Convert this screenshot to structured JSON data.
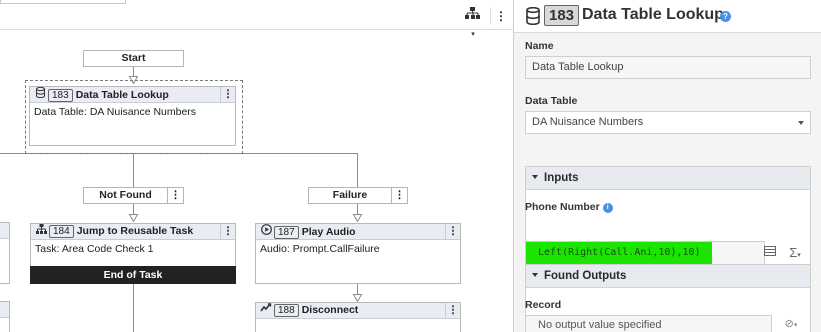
{
  "canvas": {
    "start_label": "Start",
    "data_table_node": {
      "id": "183",
      "title": "Data Table Lookup",
      "body": "Data Table: DA Nuisance Numbers",
      "kebab": "⋮"
    },
    "not_found_label": "Not Found",
    "failure_label": "Failure",
    "jump_node": {
      "id": "184",
      "title": "Jump to Reusable Task",
      "body": "Task: Area Code Check 1",
      "footer": "End of Task",
      "kebab": "⋮"
    },
    "play_audio_node": {
      "id": "187",
      "title": "Play Audio",
      "body": "Audio: Prompt.CallFailure",
      "kebab": "⋮"
    },
    "disconnect_node": {
      "id": "188",
      "title": "Disconnect",
      "kebab": "⋮"
    },
    "kebab": "⋮"
  },
  "panel": {
    "id": "183",
    "title": "Data Table Lookup",
    "help": "?",
    "name_label": "Name",
    "name_value": "Data Table Lookup",
    "data_table_label": "Data Table",
    "data_table_value": "DA Nuisance Numbers",
    "inputs_title": "Inputs",
    "phone_number_label": "Phone Number",
    "phone_number_expression": "Left(Right(Call.Ani,10),10)",
    "found_outputs_title": "Found Outputs",
    "record_label": "Record",
    "record_placeholder": "No output value specified",
    "info": "i"
  }
}
